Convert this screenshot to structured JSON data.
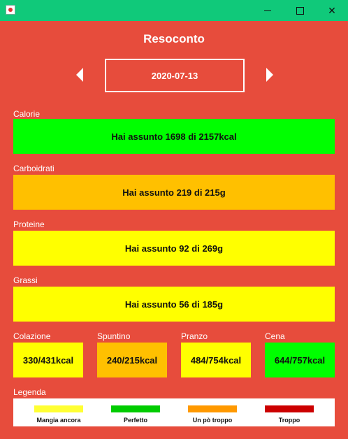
{
  "window": {
    "minimize_icon": "minimize-icon",
    "maximize_icon": "maximize-icon",
    "close_icon": "close-icon"
  },
  "header": {
    "title": "Resoconto",
    "date": "2020-07-13"
  },
  "nutrients": [
    {
      "label": "Calorie",
      "text": "Hai assunto 1698 di 2157kcal",
      "status": "Perfetto",
      "color": "#00ff00"
    },
    {
      "label": "Carboidrati",
      "text": "Hai assunto 219 di 215g",
      "status": "Un pò troppo",
      "color": "#ffc000"
    },
    {
      "label": "Proteine",
      "text": "Hai assunto 92 di 269g",
      "status": "Mangia ancora",
      "color": "#ffff00"
    },
    {
      "label": "Grassi",
      "text": "Hai assunto 56 di 185g",
      "status": "Mangia ancora",
      "color": "#ffff00"
    }
  ],
  "meals": [
    {
      "label": "Colazione",
      "text": "330/431kcal",
      "color": "#ffff00"
    },
    {
      "label": "Spuntino",
      "text": "240/215kcal",
      "color": "#ffc000"
    },
    {
      "label": "Pranzo",
      "text": "484/754kcal",
      "color": "#ffff00"
    },
    {
      "label": "Cena",
      "text": "644/757kcal",
      "color": "#00ff00"
    }
  ],
  "legend": {
    "label": "Legenda",
    "items": [
      {
        "text": "Mangia ancora",
        "color": "#ffff33"
      },
      {
        "text": "Perfetto",
        "color": "#00cc00"
      },
      {
        "text": "Un pò troppo",
        "color": "#ff9900"
      },
      {
        "text": "Troppo",
        "color": "#cc0000"
      }
    ]
  }
}
